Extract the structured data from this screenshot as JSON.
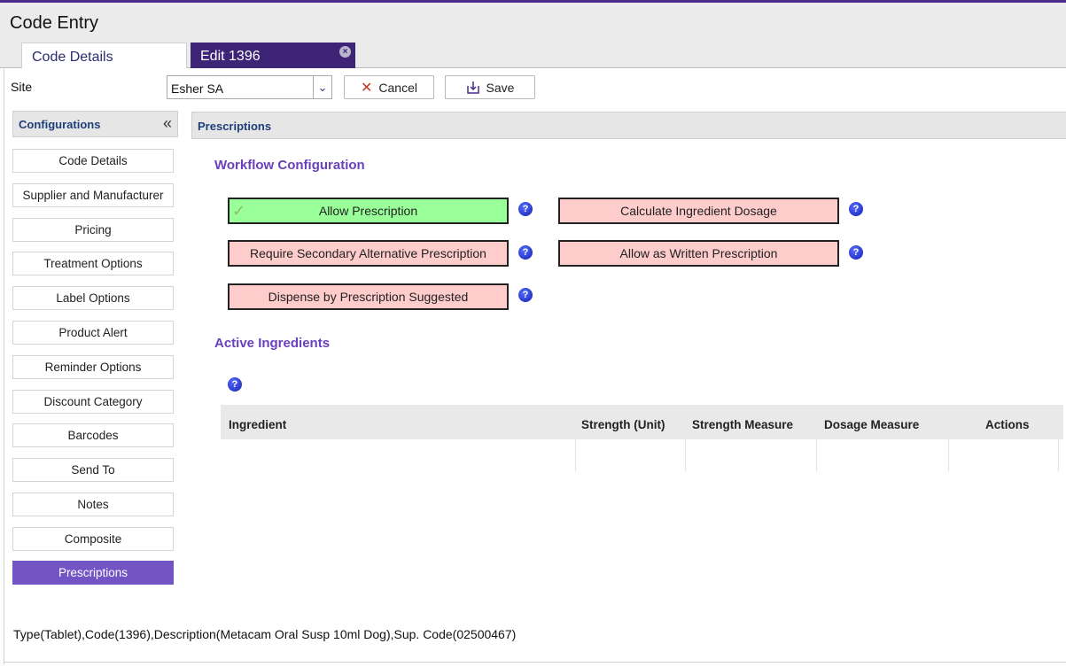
{
  "app": {
    "title": "Code Entry"
  },
  "tabs": [
    {
      "label": "Code Details"
    },
    {
      "label": "Edit 1396",
      "close": "×"
    }
  ],
  "site": {
    "label": "Site",
    "value": "Esher SA",
    "arrow": "⌄"
  },
  "toolbar": {
    "cancel_label": "Cancel",
    "cancel_icon": "✕",
    "save_label": "Save"
  },
  "sidebar": {
    "header": "Configurations",
    "collapse_icon": "«",
    "items": [
      {
        "label": "Code Details"
      },
      {
        "label": "Supplier and Manufacturer"
      },
      {
        "label": "Pricing"
      },
      {
        "label": "Treatment Options"
      },
      {
        "label": "Label Options"
      },
      {
        "label": "Product Alert"
      },
      {
        "label": "Reminder Options"
      },
      {
        "label": "Discount Category"
      },
      {
        "label": "Barcodes"
      },
      {
        "label": "Send To"
      },
      {
        "label": "Notes"
      },
      {
        "label": "Composite"
      },
      {
        "label": "Prescriptions",
        "active": true
      }
    ]
  },
  "panel": {
    "title": "Prescriptions"
  },
  "workflow": {
    "title": "Workflow Configuration",
    "options": [
      {
        "label": "Allow Prescription",
        "enabled": true
      },
      {
        "label": "Calculate Ingredient Dosage",
        "enabled": false
      },
      {
        "label": "Require Secondary Alternative Prescription",
        "enabled": false
      },
      {
        "label": "Allow as Written Prescription",
        "enabled": false
      },
      {
        "label": "Dispense by Prescription Suggested",
        "enabled": false
      }
    ],
    "help_glyph": "?"
  },
  "ingredients": {
    "title": "Active Ingredients",
    "columns": [
      "Ingredient",
      "Strength (Unit)",
      "Strength Measure",
      "Dosage Measure",
      "Actions"
    ],
    "rows": []
  },
  "footer": {
    "text": "Type(Tablet),Code(1396),Description(Metacam Oral Susp 10ml Dog),Sup. Code(02500467)"
  },
  "colors": {
    "accent": "#3e2476",
    "active_nav": "#7254c4",
    "section_title": "#6a40bd",
    "option_on": "#99ff99",
    "option_off": "#ffcccc"
  }
}
